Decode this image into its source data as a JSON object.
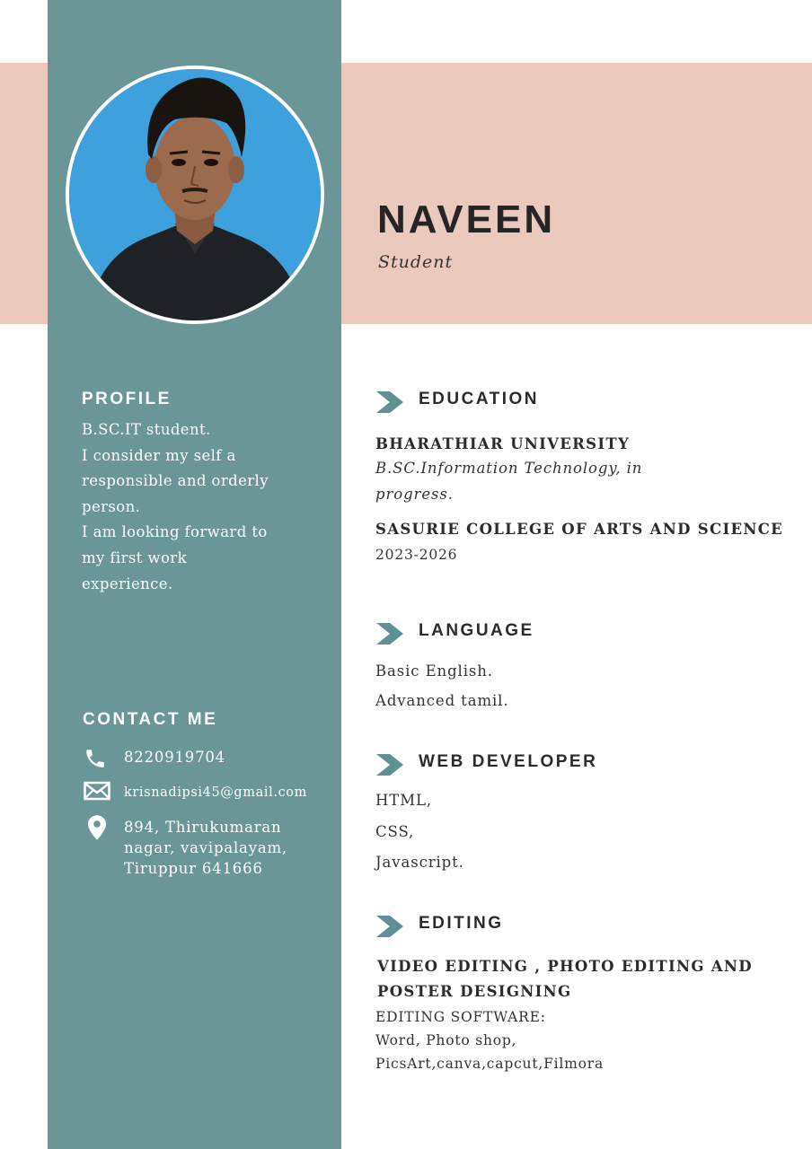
{
  "header": {
    "name": "NAVEEN",
    "title": "Student"
  },
  "colors": {
    "sidebar": "#6a9698",
    "header_band": "#ebc9bd",
    "accent": "#5f9096",
    "text": "#2b2b2b"
  },
  "profile": {
    "heading": "PROFILE",
    "lines": [
      "B.SC.IT student.",
      "I consider my self a",
      "responsible and orderly",
      "person.",
      "I am looking forward to",
      "my first work",
      "experience."
    ]
  },
  "contact": {
    "heading": "CONTACT ME",
    "phone": "8220919704",
    "email": "krisnadipsi45@gmail.com",
    "address_lines": [
      "894, Thirukumaran",
      "nagar, vavipalayam,",
      "Tiruppur 641666"
    ]
  },
  "education": {
    "heading": "EDUCATION",
    "items": [
      {
        "institution": "BHARATHIAR UNIVERSITY",
        "detail_lines": [
          "B.SC.Information Technology, in",
          "progress."
        ]
      },
      {
        "institution": "SASURIE COLLEGE OF ARTS AND SCIENCE",
        "years": "2023-2026"
      }
    ]
  },
  "language": {
    "heading": "LANGUAGE",
    "items": [
      "Basic English.",
      "Advanced tamil."
    ]
  },
  "web_developer": {
    "heading": "WEB DEVELOPER",
    "items": [
      "HTML,",
      "CSS,",
      "Javascript."
    ]
  },
  "editing": {
    "heading": "EDITING",
    "title_lines": [
      "VIDEO EDITING , PHOTO EDITING AND",
      "POSTER DESIGNING"
    ],
    "software_label": "EDITING SOFTWARE:",
    "software_lines": [
      "Word, Photo shop,",
      "PicsArt,canva,capcut,Filmora"
    ]
  },
  "icons": {
    "section": "chevron-right-icon",
    "phone": "phone-icon",
    "email": "envelope-icon",
    "address": "map-pin-icon"
  }
}
